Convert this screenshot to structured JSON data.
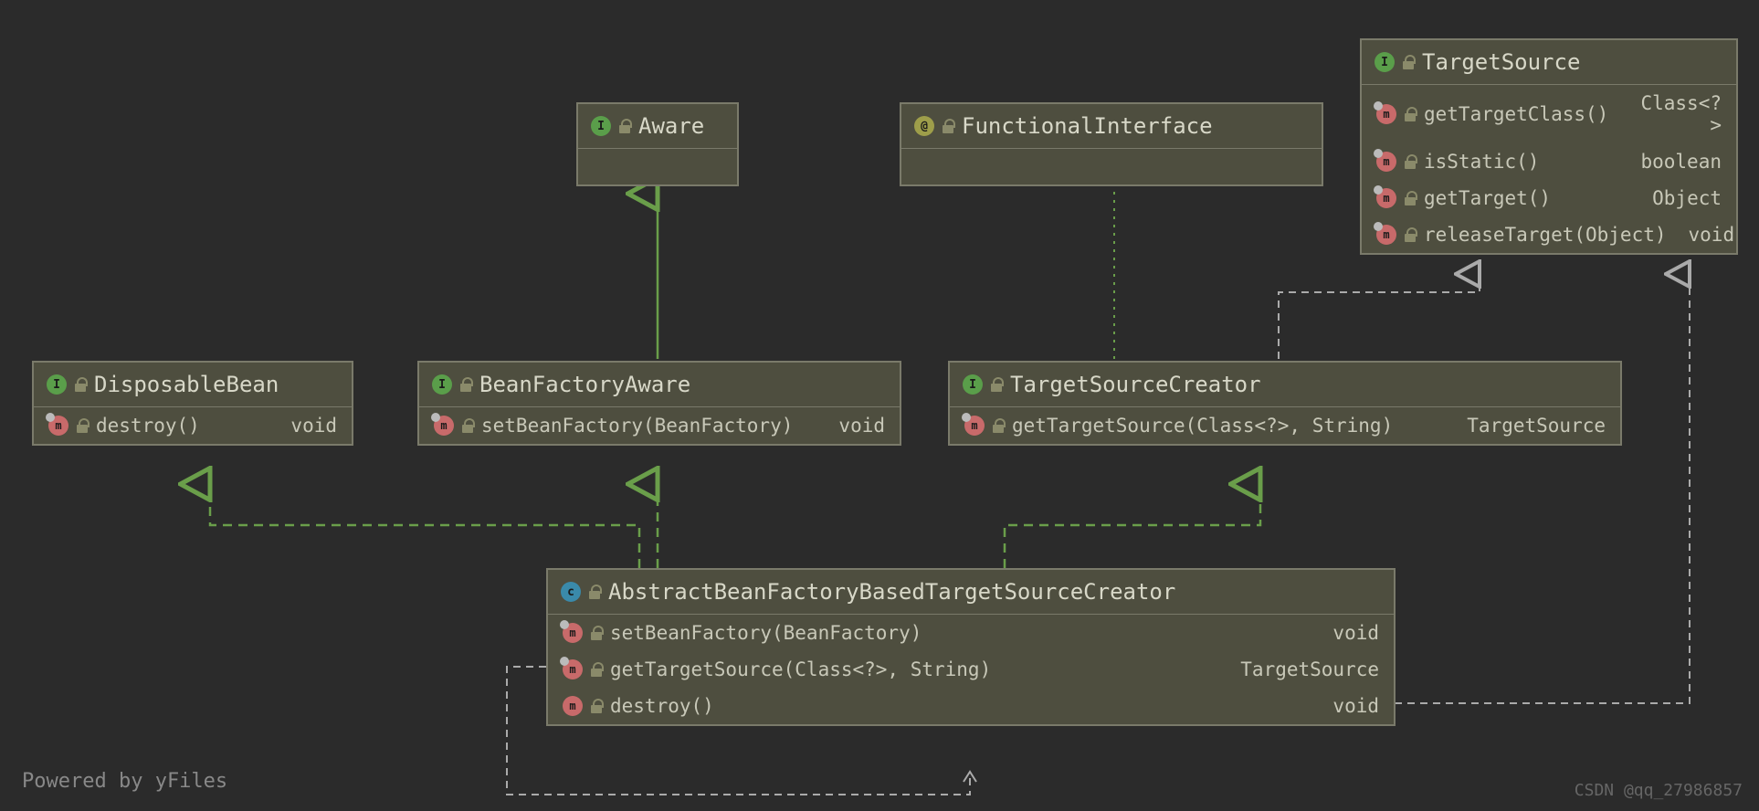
{
  "boxes": {
    "aware": {
      "title": "Aware"
    },
    "functionalInterface": {
      "title": "FunctionalInterface"
    },
    "targetSource": {
      "title": "TargetSource",
      "members": [
        {
          "name": "getTargetClass()",
          "ret": "Class<?>"
        },
        {
          "name": "isStatic()",
          "ret": "boolean"
        },
        {
          "name": "getTarget()",
          "ret": "Object"
        },
        {
          "name": "releaseTarget(Object)",
          "ret": "void"
        }
      ]
    },
    "disposableBean": {
      "title": "DisposableBean",
      "members": [
        {
          "name": "destroy()",
          "ret": "void"
        }
      ]
    },
    "beanFactoryAware": {
      "title": "BeanFactoryAware",
      "members": [
        {
          "name": "setBeanFactory(BeanFactory)",
          "ret": "void"
        }
      ]
    },
    "targetSourceCreator": {
      "title": "TargetSourceCreator",
      "members": [
        {
          "name": "getTargetSource(Class<?>, String)",
          "ret": "TargetSource"
        }
      ]
    },
    "abstractCreator": {
      "title": "AbstractBeanFactoryBasedTargetSourceCreator",
      "members": [
        {
          "name": "setBeanFactory(BeanFactory)",
          "ret": "void",
          "abstract": true
        },
        {
          "name": "getTargetSource(Class<?>, String)",
          "ret": "TargetSource",
          "abstract": true
        },
        {
          "name": "destroy()",
          "ret": "void",
          "abstract": false
        }
      ]
    }
  },
  "footer": {
    "left": "Powered by yFiles",
    "right": "CSDN @qq_27986857"
  }
}
